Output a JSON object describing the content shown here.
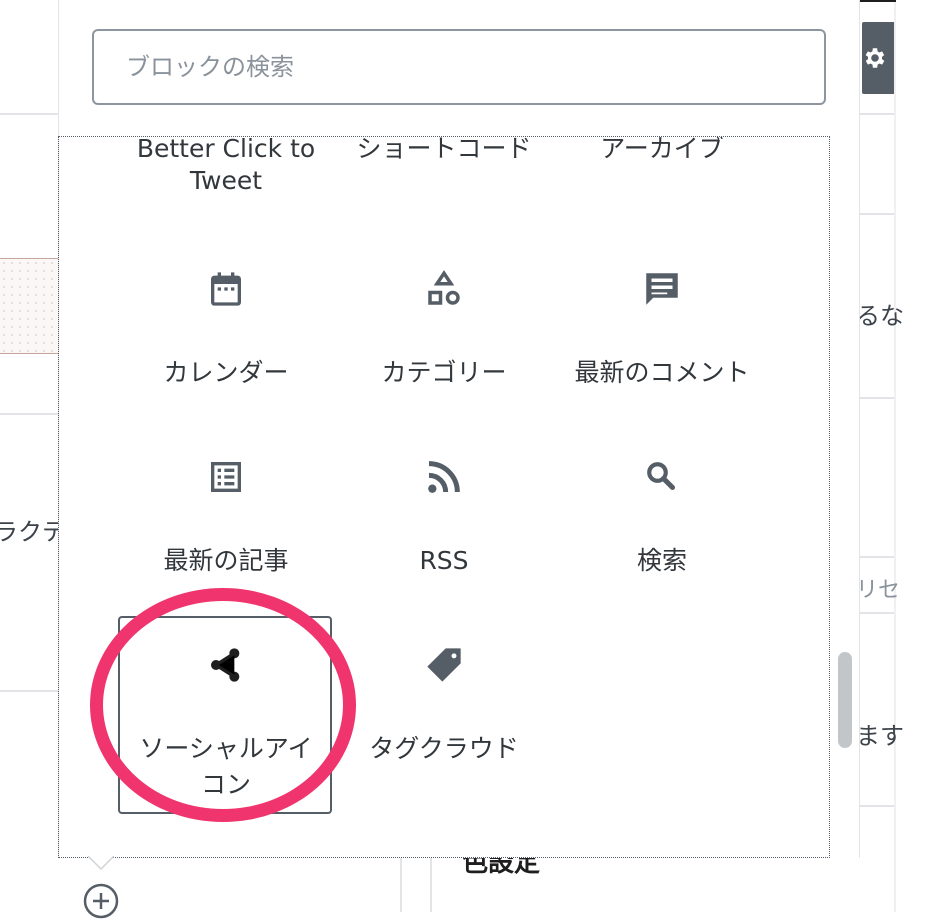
{
  "search": {
    "placeholder": "ブロックの検索",
    "value": ""
  },
  "blocks_partial": [
    {
      "name": "better-click-to-tweet",
      "label": "Better Click to Tweet"
    },
    {
      "name": "shortcode",
      "label": "ショートコード"
    },
    {
      "name": "archives",
      "label": "アーカイブ"
    }
  ],
  "blocks": [
    {
      "name": "calendar",
      "label": "カレンダー",
      "icon": "calendar-icon"
    },
    {
      "name": "categories",
      "label": "カテゴリー",
      "icon": "shapes-icon"
    },
    {
      "name": "latest-comments",
      "label": "最新のコメント",
      "icon": "comment-icon"
    },
    {
      "name": "latest-posts",
      "label": "最新の記事",
      "icon": "post-list-icon"
    },
    {
      "name": "rss",
      "label": "RSS",
      "icon": "rss-icon"
    },
    {
      "name": "search",
      "label": "検索",
      "icon": "search-icon"
    },
    {
      "name": "social-icons",
      "label": "ソーシャルアイコン",
      "icon": "share-icon",
      "selected": true
    },
    {
      "name": "tag-cloud",
      "label": "タグクラウド",
      "icon": "tag-icon"
    }
  ],
  "background": {
    "left_text": "ラクテ",
    "right_text_1": "るな",
    "right_text_2": "リセ",
    "right_text_3": "ます",
    "bottom_text": "色設定"
  },
  "colors": {
    "highlight": "#f0356e",
    "sidebar_button": "#555d66"
  }
}
